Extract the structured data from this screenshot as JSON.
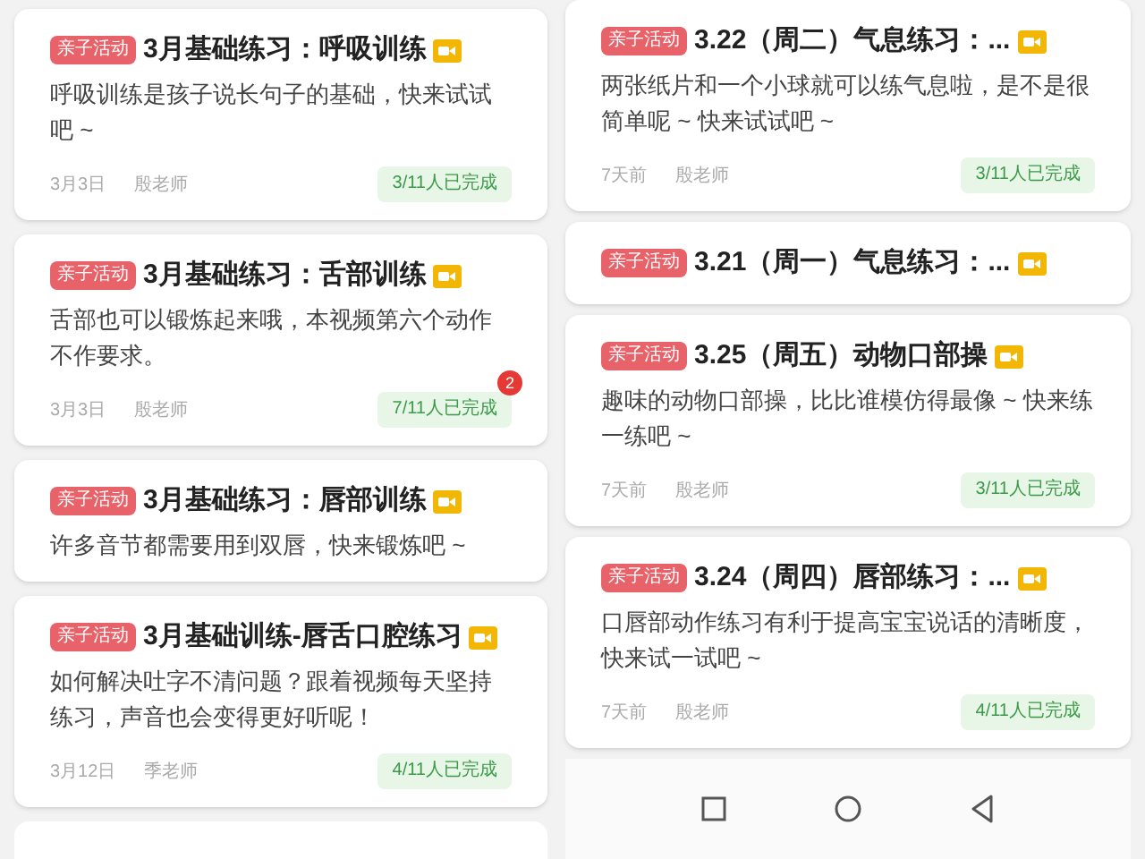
{
  "left_column": {
    "cards": [
      {
        "tag": "亲子活动",
        "title": "3月基础练习：呼吸训练",
        "description": "呼吸训练是孩子说长句子的基础，快来试试吧 ~",
        "date": "3月3日",
        "teacher": "殷老师",
        "progress": "3/11人已完成"
      },
      {
        "tag": "亲子活动",
        "title": "3月基础练习：舌部训练",
        "description": "舌部也可以锻炼起来哦，本视频第六个动作不作要求。",
        "date": "3月3日",
        "teacher": "殷老师",
        "progress": "7/11人已完成",
        "notification": "2"
      },
      {
        "tag": "亲子活动",
        "title": "3月基础练习：唇部训练",
        "description": "许多音节都需要用到双唇，快来锻炼吧 ~"
      },
      {
        "tag": "亲子活动",
        "title": "3月基础训练-唇舌口腔练习",
        "description": "如何解决吐字不清问题？跟着视频每天坚持练习，声音也会变得更好听呢！",
        "date": "3月12日",
        "teacher": "季老师",
        "progress": "4/11人已完成"
      }
    ]
  },
  "right_column": {
    "cards": [
      {
        "tag": "亲子活动",
        "title": "3.22（周二）气息练习：...",
        "description": "两张纸片和一个小球就可以练气息啦，是不是很简单呢 ~ 快来试试吧 ~",
        "date": "7天前",
        "teacher": "殷老师",
        "progress": "3/11人已完成"
      },
      {
        "tag": "亲子活动",
        "title": "3.21（周一）气息练习：..."
      },
      {
        "tag": "亲子活动",
        "title": "3.25（周五）动物口部操",
        "description": "趣味的动物口部操，比比谁模仿得最像 ~ 快来练一练吧 ~",
        "date": "7天前",
        "teacher": "殷老师",
        "progress": "3/11人已完成"
      },
      {
        "tag": "亲子活动",
        "title": "3.24（周四）唇部练习：...",
        "description": "口唇部动作练习有利于提高宝宝说话的清晰度，快来试一试吧 ~",
        "date": "7天前",
        "teacher": "殷老师",
        "progress": "4/11人已完成"
      }
    ]
  }
}
